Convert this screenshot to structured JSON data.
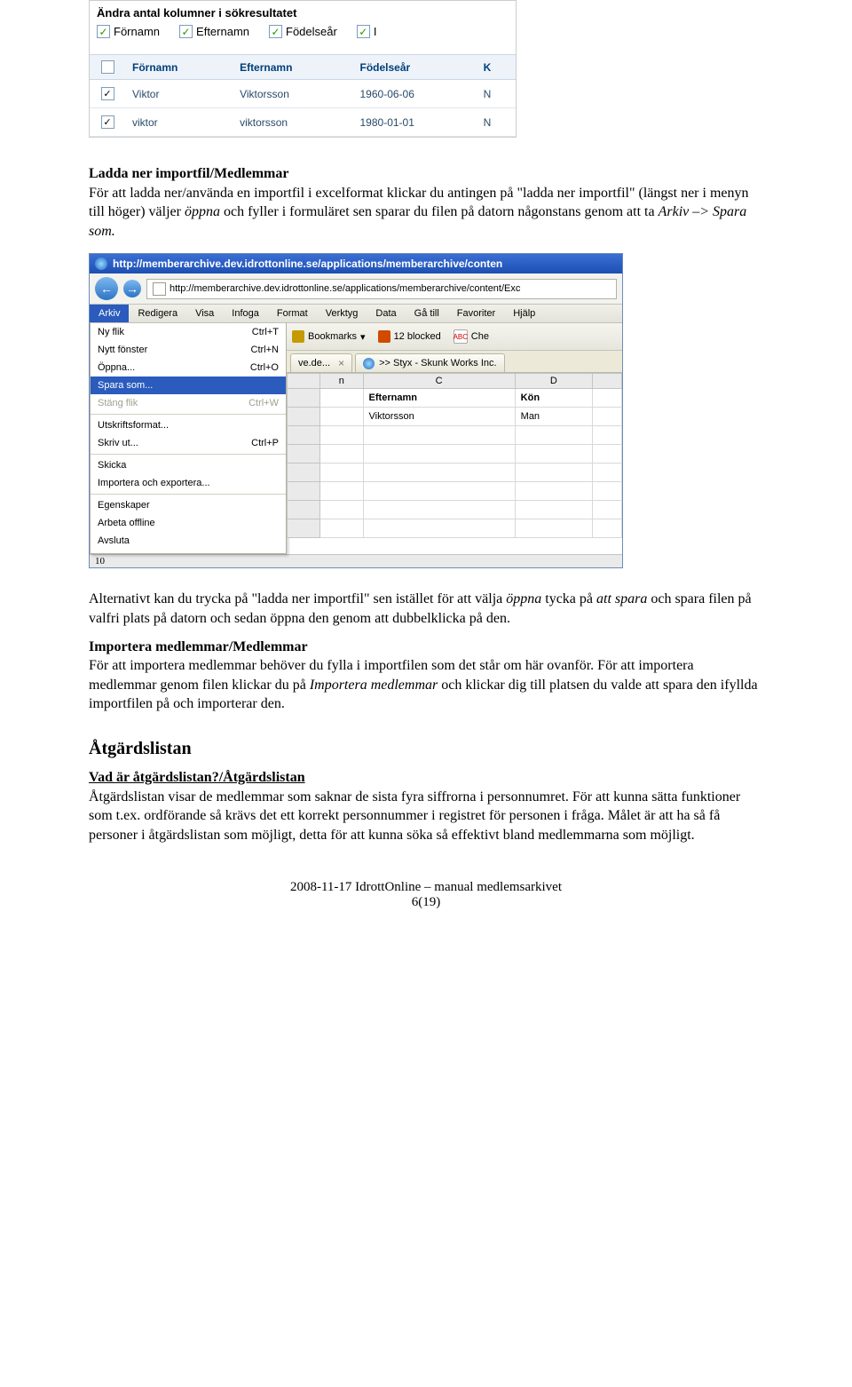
{
  "screenshot1": {
    "title": "Ändra antal kolumner i sökresultatet",
    "top_checks": [
      "Förnamn",
      "Efternamn",
      "Födelseår",
      "I"
    ],
    "table_headers": [
      "",
      "Förnamn",
      "Efternamn",
      "Födelseår",
      "K"
    ],
    "rows": [
      {
        "checked": true,
        "fornamn": "Viktor",
        "efternamn": "Viktorsson",
        "ar": "1960-06-06",
        "k": "N"
      },
      {
        "checked": true,
        "fornamn": "viktor",
        "efternamn": "viktorsson",
        "ar": "1980-01-01",
        "k": "N"
      }
    ]
  },
  "sections": {
    "ladda_title": "Ladda ner importfil/Medlemmar",
    "ladda_body_1": "För att ladda ner/använda en importfil i excelformat klickar du antingen på \"ladda ner importfil\" (längst ner i menyn till höger) väljer ",
    "ladda_body_i1": "öppna",
    "ladda_body_2": " och fyller i formuläret sen sparar du filen på datorn någonstans genom att ta ",
    "ladda_body_i2": "Arkiv –> Spara som.",
    "alt_body_1": "Alternativt kan du trycka på \"ladda ner importfil\" sen istället för att välja ",
    "alt_i1": "öppna",
    "alt_body_2": " tycka på ",
    "alt_i2": "att spara",
    "alt_body_3": " och spara filen på valfri plats på datorn och sedan öppna den genom att dubbelklicka på den.",
    "import_title": "Importera medlemmar/Medlemmar",
    "import_body_1": "För att importera medlemmar behöver du fylla i importfilen som det står om här ovanför. För att importera medlemmar genom filen klickar du på ",
    "import_i1": "Importera medlemmar",
    "import_body_2": " och klickar dig till platsen du valde att spara den ifyllda importfilen på och importerar den.",
    "atgard_title": "Åtgärdslistan",
    "atgard_sub": "Vad är åtgärdslistan?/Åtgärdslistan",
    "atgard_body": "Åtgärdslistan visar de medlemmar som saknar de sista fyra siffrorna i personnumret. För att kunna sätta funktioner som t.ex. ordförande så krävs det ett korrekt personnummer i registret för personen i fråga. Målet är att ha så få personer i åtgärdslistan som möjligt, detta för att kunna söka så effektivt bland medlemmarna som möjligt."
  },
  "screenshot2": {
    "titlebar": "http://memberarchive.dev.idrottonline.se/applications/memberarchive/conten",
    "address": "http://memberarchive.dev.idrottonline.se/applications/memberarchive/content/Exc",
    "menus": [
      "Arkiv",
      "Redigera",
      "Visa",
      "Infoga",
      "Format",
      "Verktyg",
      "Data",
      "Gå till",
      "Favoriter",
      "Hjälp"
    ],
    "toolbar": {
      "bookmarks": "Bookmarks",
      "blocked": "12 blocked",
      "check": "Che"
    },
    "tabs": [
      {
        "label": "ve.de..."
      },
      {
        "label": ">> Styx - Skunk Works Inc."
      }
    ],
    "dropdown": [
      {
        "label": "Ny flik",
        "shortcut": "Ctrl+T"
      },
      {
        "label": "Nytt fönster",
        "shortcut": "Ctrl+N"
      },
      {
        "label": "Öppna...",
        "shortcut": "Ctrl+O"
      },
      {
        "label": "Spara som...",
        "selected": true
      },
      {
        "label": "Stäng flik",
        "shortcut": "Ctrl+W",
        "disabled": true
      },
      {
        "sep": true
      },
      {
        "label": "Utskriftsformat..."
      },
      {
        "label": "Skriv ut...",
        "shortcut": "Ctrl+P"
      },
      {
        "sep": true
      },
      {
        "label": "Skicka"
      },
      {
        "label": "Importera och exportera..."
      },
      {
        "sep": true
      },
      {
        "label": "Egenskaper"
      },
      {
        "label": "Arbeta offline"
      },
      {
        "label": "Avsluta"
      }
    ],
    "sheet": {
      "col_letters": [
        "n",
        "C",
        "D"
      ],
      "headers": [
        "Efternamn",
        "Kön"
      ],
      "row": {
        "efternamn": "Viktorsson",
        "kon": "Man"
      },
      "last_row_num": "10"
    }
  },
  "footer": {
    "line1": "2008-11-17 IdrottOnline – manual medlemsarkivet",
    "line2": "6(19)"
  }
}
